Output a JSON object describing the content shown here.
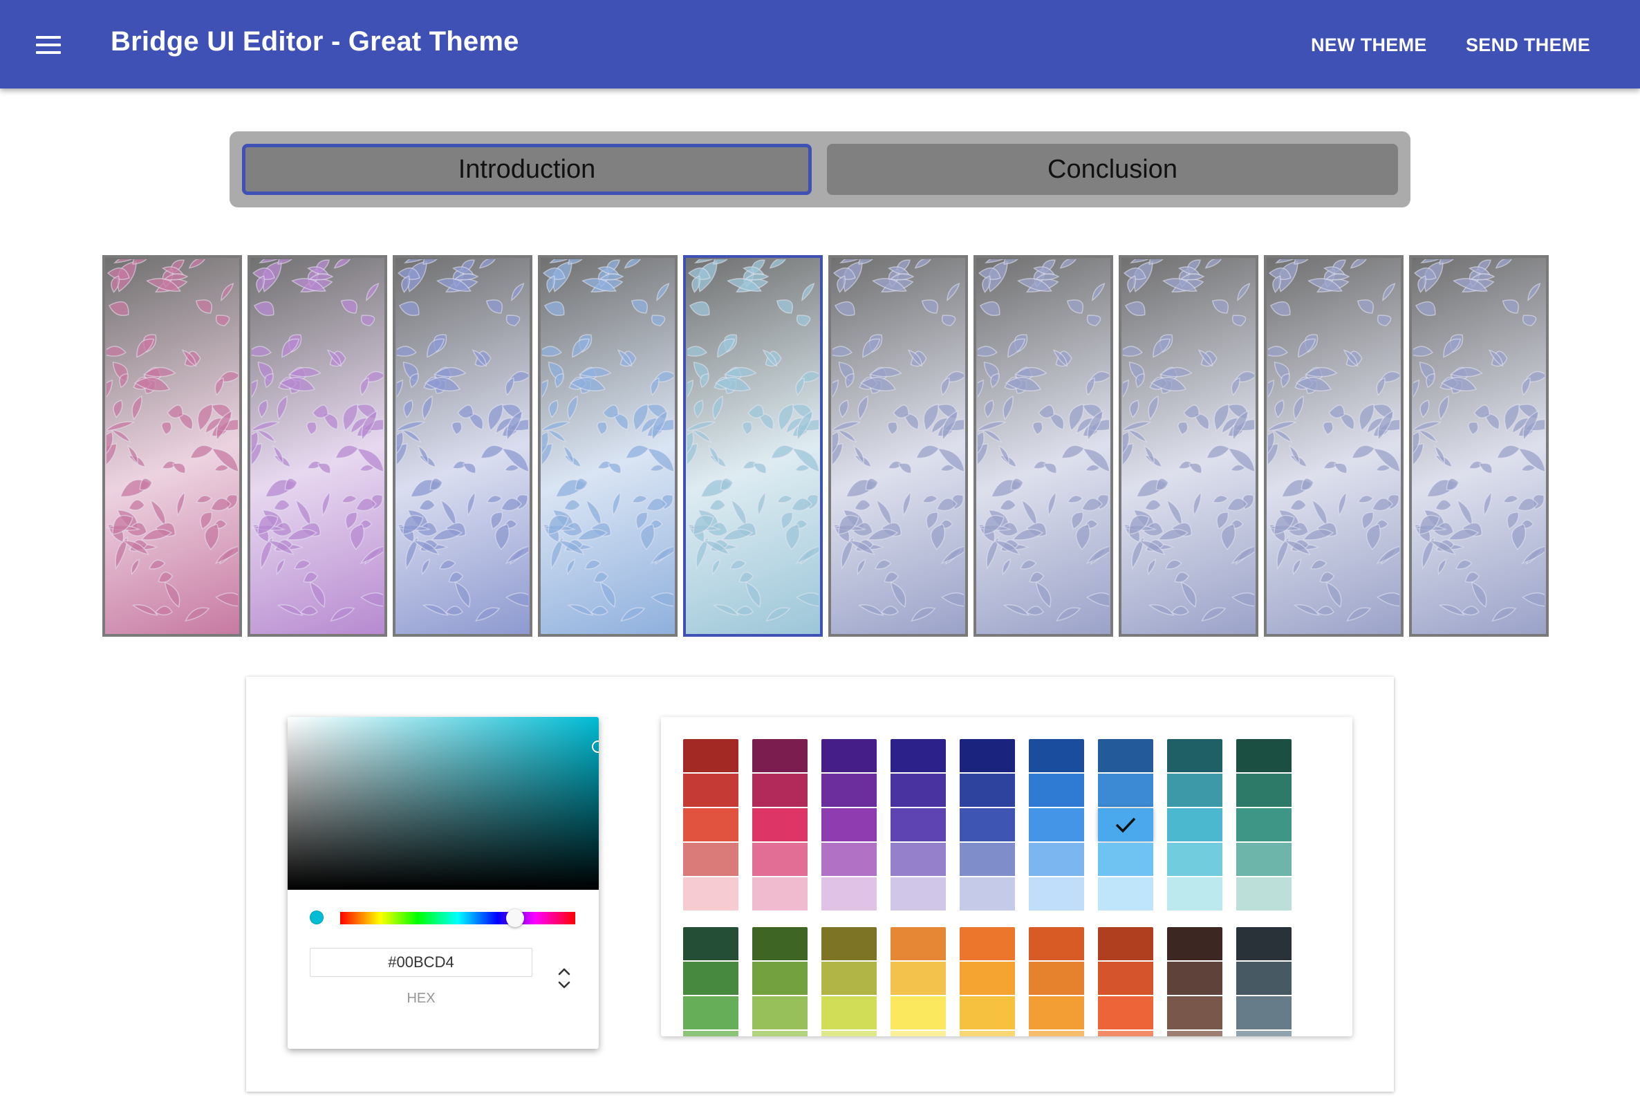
{
  "app_bar": {
    "title": "Bridge UI Editor - Great Theme",
    "new_theme_label": "NEW THEME",
    "send_theme_label": "SEND THEME",
    "menu_icon": "hamburger-menu-icon",
    "color": "#3F51B5"
  },
  "tabs": [
    {
      "label": "Introduction",
      "selected": true
    },
    {
      "label": "Conclusion",
      "selected": false
    }
  ],
  "panels": {
    "count": 10,
    "selected_index": 4,
    "tints": [
      "#c77aa2",
      "#b78ad0",
      "#8e9ad0",
      "#8fb0dd",
      "#9cc6d8",
      "#9aa2c8",
      "#9aa2c8",
      "#9aa2c8",
      "#9aa2c8",
      "#9aa2c8"
    ]
  },
  "color_picker": {
    "hex_value": "#00BCD4",
    "hex_label": "hex",
    "selected_color": "#00BCD4"
  },
  "swatch_palette": {
    "selected_group": 1,
    "selected_row": 7,
    "selected_shade": 2,
    "groups": [
      [
        [
          "#A32A24",
          "#C53A35",
          "#E1523F",
          "#DB7B79",
          "#F6CBD2"
        ],
        [
          "#7B1D4F",
          "#B22A5A",
          "#DD3666",
          "#E26E96",
          "#F0BACF"
        ],
        [
          "#451F87",
          "#6C2E9C",
          "#8E3CAF",
          "#B172C6",
          "#DFC2E5"
        ],
        [
          "#2C208A",
          "#4833A1",
          "#5E44B2",
          "#9480CB",
          "#D0C6E7"
        ],
        [
          "#1A237E",
          "#2E439D",
          "#3E55B4",
          "#7F8DCB",
          "#C5CAE9"
        ],
        [
          "#1B4D9E",
          "#2F7AD2",
          "#4494E8",
          "#7BB6F1",
          "#C0DDF9"
        ],
        [
          "#225A9A",
          "#3B8AD3",
          "#4AA9EC",
          "#6EC3F2",
          "#BEE5FA"
        ],
        [
          "#1F6066",
          "#3D98A7",
          "#4CB8CF",
          "#71CCDE",
          "#BCE9EE"
        ],
        [
          "#1B4F41",
          "#2E7A68",
          "#3E9686",
          "#6DB5AA",
          "#BDDFD9"
        ]
      ],
      [
        [
          "#244E35",
          "#46893F",
          "#66AE58",
          "#8DC47A"
        ],
        [
          "#3E6523",
          "#74A140",
          "#97C05A",
          "#B3D47F"
        ],
        [
          "#7E7425",
          "#B1B545",
          "#D2DD57",
          "#E0E98A"
        ],
        [
          "#E58734",
          "#F2C24D",
          "#FCE85E",
          "#FCF09A"
        ],
        [
          "#EC762C",
          "#F5A331",
          "#F6C13E",
          "#F8D874"
        ],
        [
          "#D85A25",
          "#E6822E",
          "#F29E35",
          "#F6BB6B"
        ],
        [
          "#AF3F1E",
          "#D6542C",
          "#EC6438",
          "#F28B68"
        ],
        [
          "#3D2722",
          "#5F4239",
          "#7A574B",
          "#9C7E73"
        ],
        [
          "#283238",
          "#475A63",
          "#667C88",
          "#90A3AE"
        ]
      ]
    ]
  }
}
